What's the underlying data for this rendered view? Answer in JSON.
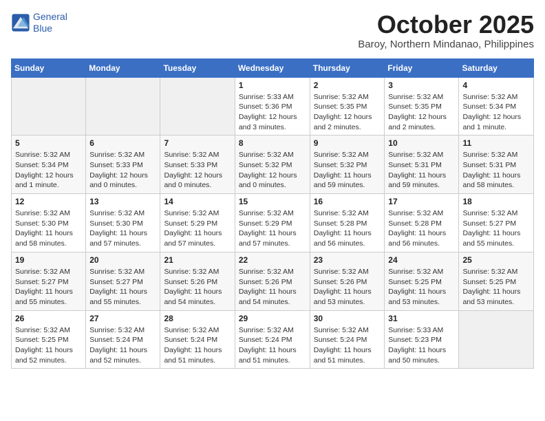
{
  "header": {
    "logo": {
      "line1": "General",
      "line2": "Blue"
    },
    "title": "October 2025",
    "location": "Baroy, Northern Mindanao, Philippines"
  },
  "days_of_week": [
    "Sunday",
    "Monday",
    "Tuesday",
    "Wednesday",
    "Thursday",
    "Friday",
    "Saturday"
  ],
  "weeks": [
    [
      {
        "day": "",
        "info": ""
      },
      {
        "day": "",
        "info": ""
      },
      {
        "day": "",
        "info": ""
      },
      {
        "day": "1",
        "info": "Sunrise: 5:33 AM\nSunset: 5:36 PM\nDaylight: 12 hours and 3 minutes."
      },
      {
        "day": "2",
        "info": "Sunrise: 5:32 AM\nSunset: 5:35 PM\nDaylight: 12 hours and 2 minutes."
      },
      {
        "day": "3",
        "info": "Sunrise: 5:32 AM\nSunset: 5:35 PM\nDaylight: 12 hours and 2 minutes."
      },
      {
        "day": "4",
        "info": "Sunrise: 5:32 AM\nSunset: 5:34 PM\nDaylight: 12 hours and 1 minute."
      }
    ],
    [
      {
        "day": "5",
        "info": "Sunrise: 5:32 AM\nSunset: 5:34 PM\nDaylight: 12 hours and 1 minute."
      },
      {
        "day": "6",
        "info": "Sunrise: 5:32 AM\nSunset: 5:33 PM\nDaylight: 12 hours and 0 minutes."
      },
      {
        "day": "7",
        "info": "Sunrise: 5:32 AM\nSunset: 5:33 PM\nDaylight: 12 hours and 0 minutes."
      },
      {
        "day": "8",
        "info": "Sunrise: 5:32 AM\nSunset: 5:32 PM\nDaylight: 12 hours and 0 minutes."
      },
      {
        "day": "9",
        "info": "Sunrise: 5:32 AM\nSunset: 5:32 PM\nDaylight: 11 hours and 59 minutes."
      },
      {
        "day": "10",
        "info": "Sunrise: 5:32 AM\nSunset: 5:31 PM\nDaylight: 11 hours and 59 minutes."
      },
      {
        "day": "11",
        "info": "Sunrise: 5:32 AM\nSunset: 5:31 PM\nDaylight: 11 hours and 58 minutes."
      }
    ],
    [
      {
        "day": "12",
        "info": "Sunrise: 5:32 AM\nSunset: 5:30 PM\nDaylight: 11 hours and 58 minutes."
      },
      {
        "day": "13",
        "info": "Sunrise: 5:32 AM\nSunset: 5:30 PM\nDaylight: 11 hours and 57 minutes."
      },
      {
        "day": "14",
        "info": "Sunrise: 5:32 AM\nSunset: 5:29 PM\nDaylight: 11 hours and 57 minutes."
      },
      {
        "day": "15",
        "info": "Sunrise: 5:32 AM\nSunset: 5:29 PM\nDaylight: 11 hours and 57 minutes."
      },
      {
        "day": "16",
        "info": "Sunrise: 5:32 AM\nSunset: 5:28 PM\nDaylight: 11 hours and 56 minutes."
      },
      {
        "day": "17",
        "info": "Sunrise: 5:32 AM\nSunset: 5:28 PM\nDaylight: 11 hours and 56 minutes."
      },
      {
        "day": "18",
        "info": "Sunrise: 5:32 AM\nSunset: 5:27 PM\nDaylight: 11 hours and 55 minutes."
      }
    ],
    [
      {
        "day": "19",
        "info": "Sunrise: 5:32 AM\nSunset: 5:27 PM\nDaylight: 11 hours and 55 minutes."
      },
      {
        "day": "20",
        "info": "Sunrise: 5:32 AM\nSunset: 5:27 PM\nDaylight: 11 hours and 55 minutes."
      },
      {
        "day": "21",
        "info": "Sunrise: 5:32 AM\nSunset: 5:26 PM\nDaylight: 11 hours and 54 minutes."
      },
      {
        "day": "22",
        "info": "Sunrise: 5:32 AM\nSunset: 5:26 PM\nDaylight: 11 hours and 54 minutes."
      },
      {
        "day": "23",
        "info": "Sunrise: 5:32 AM\nSunset: 5:26 PM\nDaylight: 11 hours and 53 minutes."
      },
      {
        "day": "24",
        "info": "Sunrise: 5:32 AM\nSunset: 5:25 PM\nDaylight: 11 hours and 53 minutes."
      },
      {
        "day": "25",
        "info": "Sunrise: 5:32 AM\nSunset: 5:25 PM\nDaylight: 11 hours and 53 minutes."
      }
    ],
    [
      {
        "day": "26",
        "info": "Sunrise: 5:32 AM\nSunset: 5:25 PM\nDaylight: 11 hours and 52 minutes."
      },
      {
        "day": "27",
        "info": "Sunrise: 5:32 AM\nSunset: 5:24 PM\nDaylight: 11 hours and 52 minutes."
      },
      {
        "day": "28",
        "info": "Sunrise: 5:32 AM\nSunset: 5:24 PM\nDaylight: 11 hours and 51 minutes."
      },
      {
        "day": "29",
        "info": "Sunrise: 5:32 AM\nSunset: 5:24 PM\nDaylight: 11 hours and 51 minutes."
      },
      {
        "day": "30",
        "info": "Sunrise: 5:32 AM\nSunset: 5:24 PM\nDaylight: 11 hours and 51 minutes."
      },
      {
        "day": "31",
        "info": "Sunrise: 5:33 AM\nSunset: 5:23 PM\nDaylight: 11 hours and 50 minutes."
      },
      {
        "day": "",
        "info": ""
      }
    ]
  ]
}
